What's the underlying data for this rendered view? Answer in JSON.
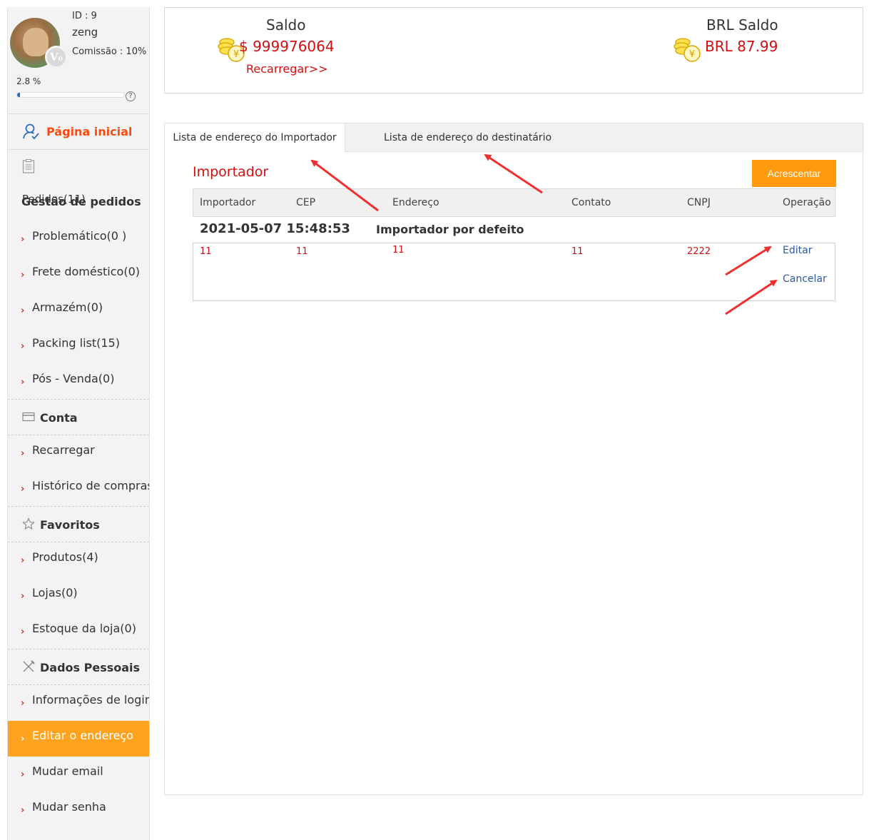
{
  "profile": {
    "id": "ID : 9",
    "name": "zeng",
    "commission": "Comissão : 10%",
    "progress_text": "2.8 %",
    "progress": 0.028,
    "help": "?",
    "badge": "V₀"
  },
  "sidebar": {
    "home": "Página inicial",
    "orders_sub": "Pedidos(11)",
    "orders_title": "Gestão de pedidos",
    "orders_items": [
      "Problemático(0 )",
      "Frete doméstico(0)",
      "Armazém(0)",
      "Packing list(15)",
      "Pós - Venda(0)"
    ],
    "account_title": "Conta",
    "account_items": [
      "Recarregar",
      "Histórico de compras"
    ],
    "favorites_title": "Favoritos",
    "favorites_items": [
      "Produtos(4)",
      "Lojas(0)",
      "Estoque da loja(0)"
    ],
    "personal_title": "Dados Pessoais",
    "personal_items": [
      "Informações de login",
      "Editar o endereço",
      "Mudar email",
      "Mudar senha"
    ],
    "chevron": "›",
    "accent": "#ffa21d",
    "home_color": "#ff4a0e"
  },
  "balance": {
    "saldo_label": "Saldo",
    "saldo_amount": "$ 999976064",
    "recharge": "Recarregar>>",
    "brl_label": "BRL Saldo",
    "brl_amount": "BRL 87.99",
    "amount_color": "#d10f10"
  },
  "tabs": {
    "importer": "Lista de endereço do Importador",
    "recipient": "Lista de endereço do destinatário"
  },
  "importer": {
    "title": "Importador",
    "add_button": "Acrescentar",
    "columns": [
      "Importador",
      "CEP",
      "Endereço",
      "Contato",
      "CNPJ",
      "Operação"
    ],
    "date": "2021-05-07 15:48:53",
    "default_label": "Importador por defeito",
    "row": [
      "11",
      "11",
      "11",
      "11",
      "2222"
    ],
    "edit": "Editar",
    "cancel": "Cancelar",
    "button_color": "#ff9a0f"
  }
}
